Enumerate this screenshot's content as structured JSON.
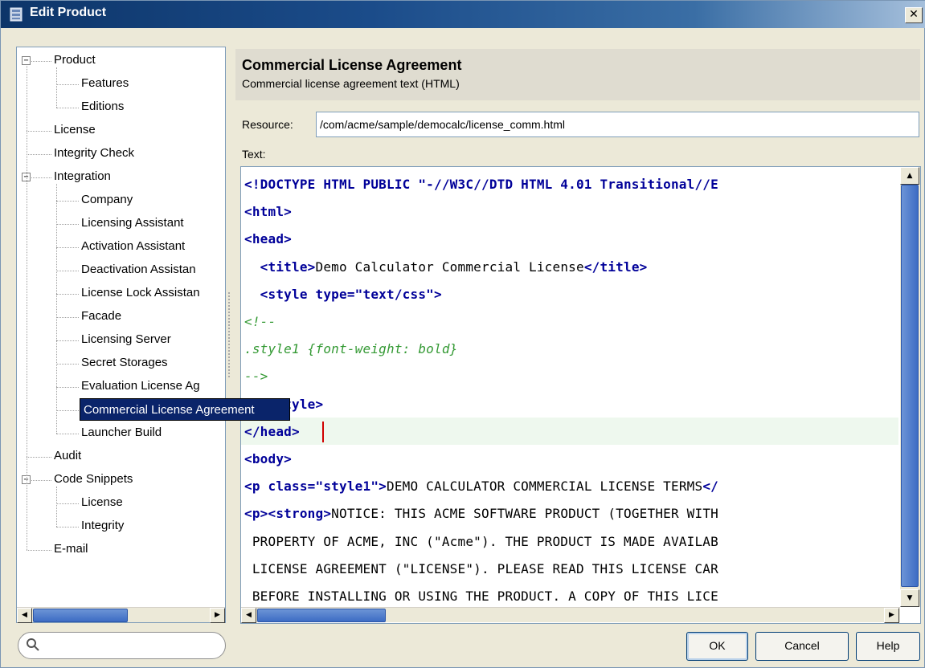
{
  "window": {
    "title": "Edit Product",
    "close_glyph": "✕"
  },
  "tree": {
    "items": [
      {
        "label": "Product",
        "level": 0,
        "expander": "−"
      },
      {
        "label": "Features",
        "level": 1
      },
      {
        "label": "Editions",
        "level": 1
      },
      {
        "label": "License",
        "level": 0
      },
      {
        "label": "Integrity Check",
        "level": 0
      },
      {
        "label": "Integration",
        "level": 0,
        "expander": "−"
      },
      {
        "label": "Company",
        "level": 1
      },
      {
        "label": "Licensing Assistant",
        "level": 1
      },
      {
        "label": "Activation Assistant",
        "level": 1
      },
      {
        "label": "Deactivation Assistan",
        "level": 1
      },
      {
        "label": "License Lock Assistan",
        "level": 1
      },
      {
        "label": "Facade",
        "level": 1
      },
      {
        "label": "Licensing Server",
        "level": 1
      },
      {
        "label": "Secret Storages",
        "level": 1
      },
      {
        "label": "Evaluation License Ag",
        "level": 1
      },
      {
        "label": "Commercial License Agreement",
        "level": 1,
        "selected": true
      },
      {
        "label": "Launcher Build",
        "level": 1
      },
      {
        "label": "Audit",
        "level": 0
      },
      {
        "label": "Code Snippets",
        "level": 0,
        "expander": "−"
      },
      {
        "label": "License",
        "level": 1
      },
      {
        "label": "Integrity",
        "level": 1
      },
      {
        "label": "E-mail",
        "level": 0
      }
    ]
  },
  "search": {
    "icon": "magnifier-icon",
    "value": ""
  },
  "panel": {
    "title": "Commercial License Agreement",
    "subtitle": "Commercial license agreement text (HTML)",
    "resource_label": "Resource:",
    "resource_value": "/com/acme/sample/democalc/license_comm.html",
    "text_label": "Text:"
  },
  "editor": {
    "lines": [
      [
        {
          "t": "<!DOCTYPE HTML PUBLIC \"-//W3C//DTD HTML 4.01 Transitional//E",
          "c": "tag"
        }
      ],
      [
        {
          "t": "<html>",
          "c": "tag"
        }
      ],
      [
        {
          "t": "<head>",
          "c": "tag"
        }
      ],
      [
        {
          "t": "  ",
          "c": ""
        },
        {
          "t": "<title>",
          "c": "tag"
        },
        {
          "t": "Demo Calculator Commercial License",
          "c": ""
        },
        {
          "t": "</title>",
          "c": "tag"
        }
      ],
      [
        {
          "t": "  ",
          "c": ""
        },
        {
          "t": "<style type=\"text/css\">",
          "c": "tag"
        }
      ],
      [
        {
          "t": "<!--",
          "c": "comment"
        }
      ],
      [
        {
          "t": ".style1 {font-weight: bold}",
          "c": "comment"
        }
      ],
      [
        {
          "t": "-->",
          "c": "comment"
        }
      ],
      [
        {
          "t": "  </style>",
          "c": "tag"
        }
      ],
      [
        {
          "t": "</head>",
          "c": "tag"
        }
      ],
      [
        {
          "t": "<body>",
          "c": "tag"
        }
      ],
      [
        {
          "t": "<p class=\"style1\">",
          "c": "tag"
        },
        {
          "t": "DEMO CALCULATOR COMMERCIAL LICENSE TERMS",
          "c": ""
        },
        {
          "t": "</",
          "c": "tag"
        }
      ],
      [
        {
          "t": "<p><strong>",
          "c": "tag"
        },
        {
          "t": "NOTICE: THIS ACME SOFTWARE PRODUCT (TOGETHER WITH",
          "c": ""
        }
      ],
      [
        {
          "t": " PROPERTY OF ACME, INC (\"Acme\"). THE PRODUCT IS MADE AVAILAB",
          "c": ""
        }
      ],
      [
        {
          "t": " LICENSE AGREEMENT (\"LICENSE\"). PLEASE READ THIS LICENSE CAR",
          "c": ""
        }
      ],
      [
        {
          "t": " BEFORE INSTALLING OR USING THE PRODUCT. A COPY OF THIS LICE",
          "c": ""
        }
      ]
    ],
    "caret_line": 9
  },
  "buttons": {
    "ok": "OK",
    "cancel": "Cancel",
    "help": "Help"
  },
  "colors": {
    "tag": "#000099",
    "comment": "#339933",
    "selection": "#0a246a"
  }
}
